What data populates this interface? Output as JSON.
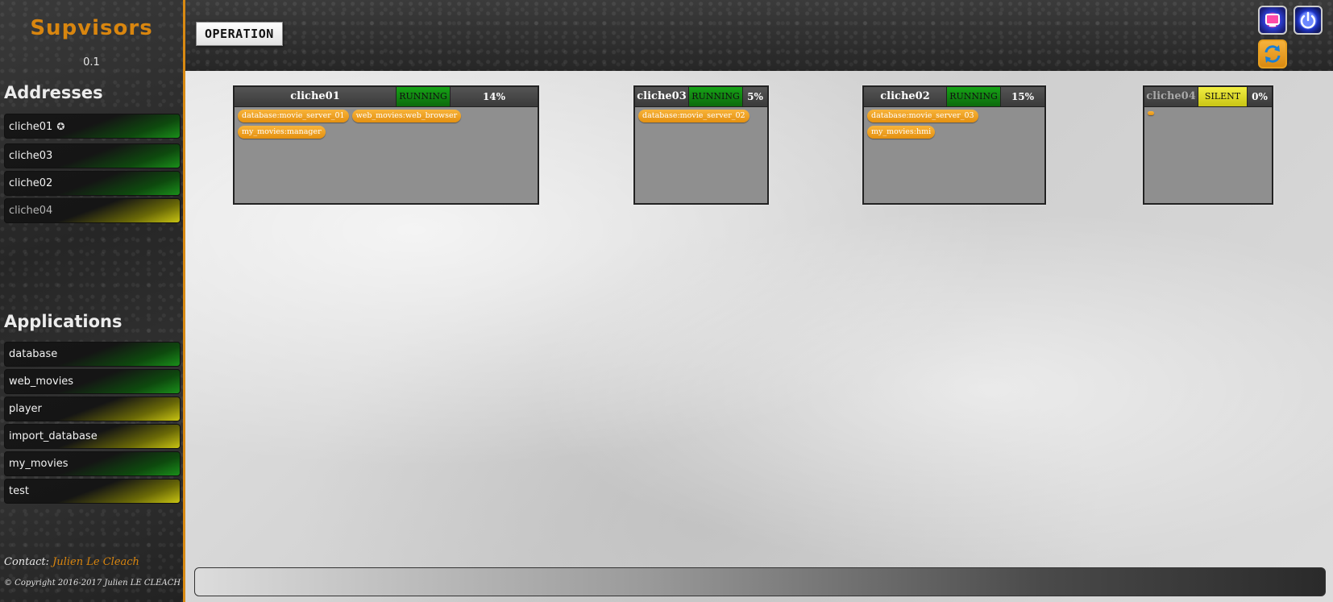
{
  "sidebar": {
    "brand": "Supvisors",
    "version": "0.1",
    "addresses_title": "Addresses",
    "addresses": [
      {
        "label": "cliche01",
        "state": "green",
        "local": true
      },
      {
        "label": "cliche03",
        "state": "green",
        "local": false
      },
      {
        "label": "cliche02",
        "state": "green",
        "local": false
      },
      {
        "label": "cliche04",
        "state": "yellow",
        "local": false
      }
    ],
    "applications_title": "Applications",
    "applications": [
      {
        "label": "database",
        "state": "green"
      },
      {
        "label": "web_movies",
        "state": "green"
      },
      {
        "label": "player",
        "state": "yellow"
      },
      {
        "label": "import_database",
        "state": "yellow"
      },
      {
        "label": "my_movies",
        "state": "green"
      },
      {
        "label": "test",
        "state": "yellow"
      }
    ],
    "contact_label": "Contact:",
    "contact_name": "Julien Le Cleach",
    "copyright": "© Copyright 2016-2017 Julien LE CLEACH"
  },
  "header": {
    "title": "OPERATION",
    "buttons": [
      "restart-icon",
      "shutdown-icon",
      "refresh-icon"
    ]
  },
  "nodes": [
    {
      "name": "cliche01",
      "state": "RUNNING",
      "load": "14%",
      "processes": [
        "database:movie_server_01",
        "web_movies:web_browser",
        "my_movies:manager"
      ]
    },
    {
      "name": "cliche03",
      "state": "RUNNING",
      "load": "5%",
      "processes": [
        "database:movie_server_02"
      ]
    },
    {
      "name": "cliche02",
      "state": "RUNNING",
      "load": "15%",
      "processes": [
        "database:movie_server_03",
        "my_movies:hmi"
      ]
    },
    {
      "name": "cliche04",
      "state": "SILENT",
      "load": "0%",
      "processes": []
    }
  ],
  "colors": {
    "accent": "#d9860f",
    "running": "#17a317",
    "silent": "#f2ef42",
    "process": "#f8b43a"
  }
}
